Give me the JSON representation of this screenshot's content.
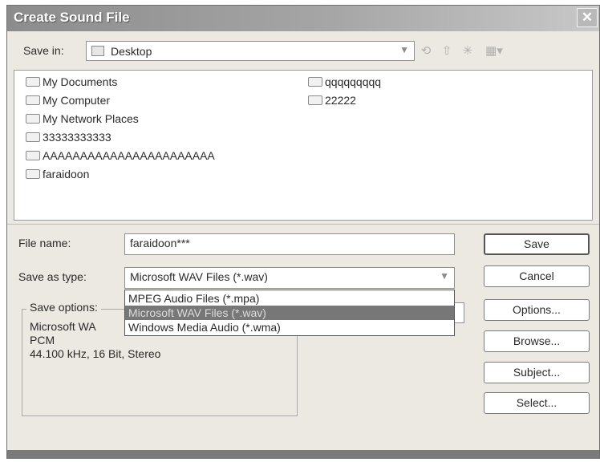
{
  "window": {
    "title": "Create Sound File"
  },
  "save_in": {
    "label": "Save in:",
    "value": "Desktop"
  },
  "toolbar": {
    "icons": [
      "back-icon",
      "up-folder-icon",
      "new-folder-icon",
      "view-menu-icon"
    ]
  },
  "files": {
    "column1": [
      "My Documents",
      "My Computer",
      "My Network Places",
      "33333333333",
      "AAAAAAAAAAAAAAAAAAAAAAA",
      "faraidoon"
    ],
    "column2": [
      "qqqqqqqqq",
      "22222"
    ]
  },
  "file_name": {
    "label": "File name:",
    "value": "faraidoon***"
  },
  "save_as_type": {
    "label": "Save as type:",
    "value": "Microsoft WAV Files (*.wav)",
    "options": [
      "MPEG Audio Files (*.mpa)",
      "Microsoft WAV Files (*.wav)",
      "Windows Media Audio (*.wma)"
    ],
    "selected_index": 1
  },
  "save_options": {
    "label": "Save options:",
    "lines": [
      "Microsoft WA",
      "PCM",
      "44.100 kHz, 16 Bit, Stereo"
    ]
  },
  "buttons": {
    "save": "Save",
    "cancel": "Cancel",
    "options": "Options...",
    "browse": "Browse...",
    "subject": "Subject...",
    "select": "Select..."
  },
  "colors": {
    "dialog_bg": "#ece9e2",
    "titlebar": "#9a9a9a",
    "selection": "#777777"
  }
}
